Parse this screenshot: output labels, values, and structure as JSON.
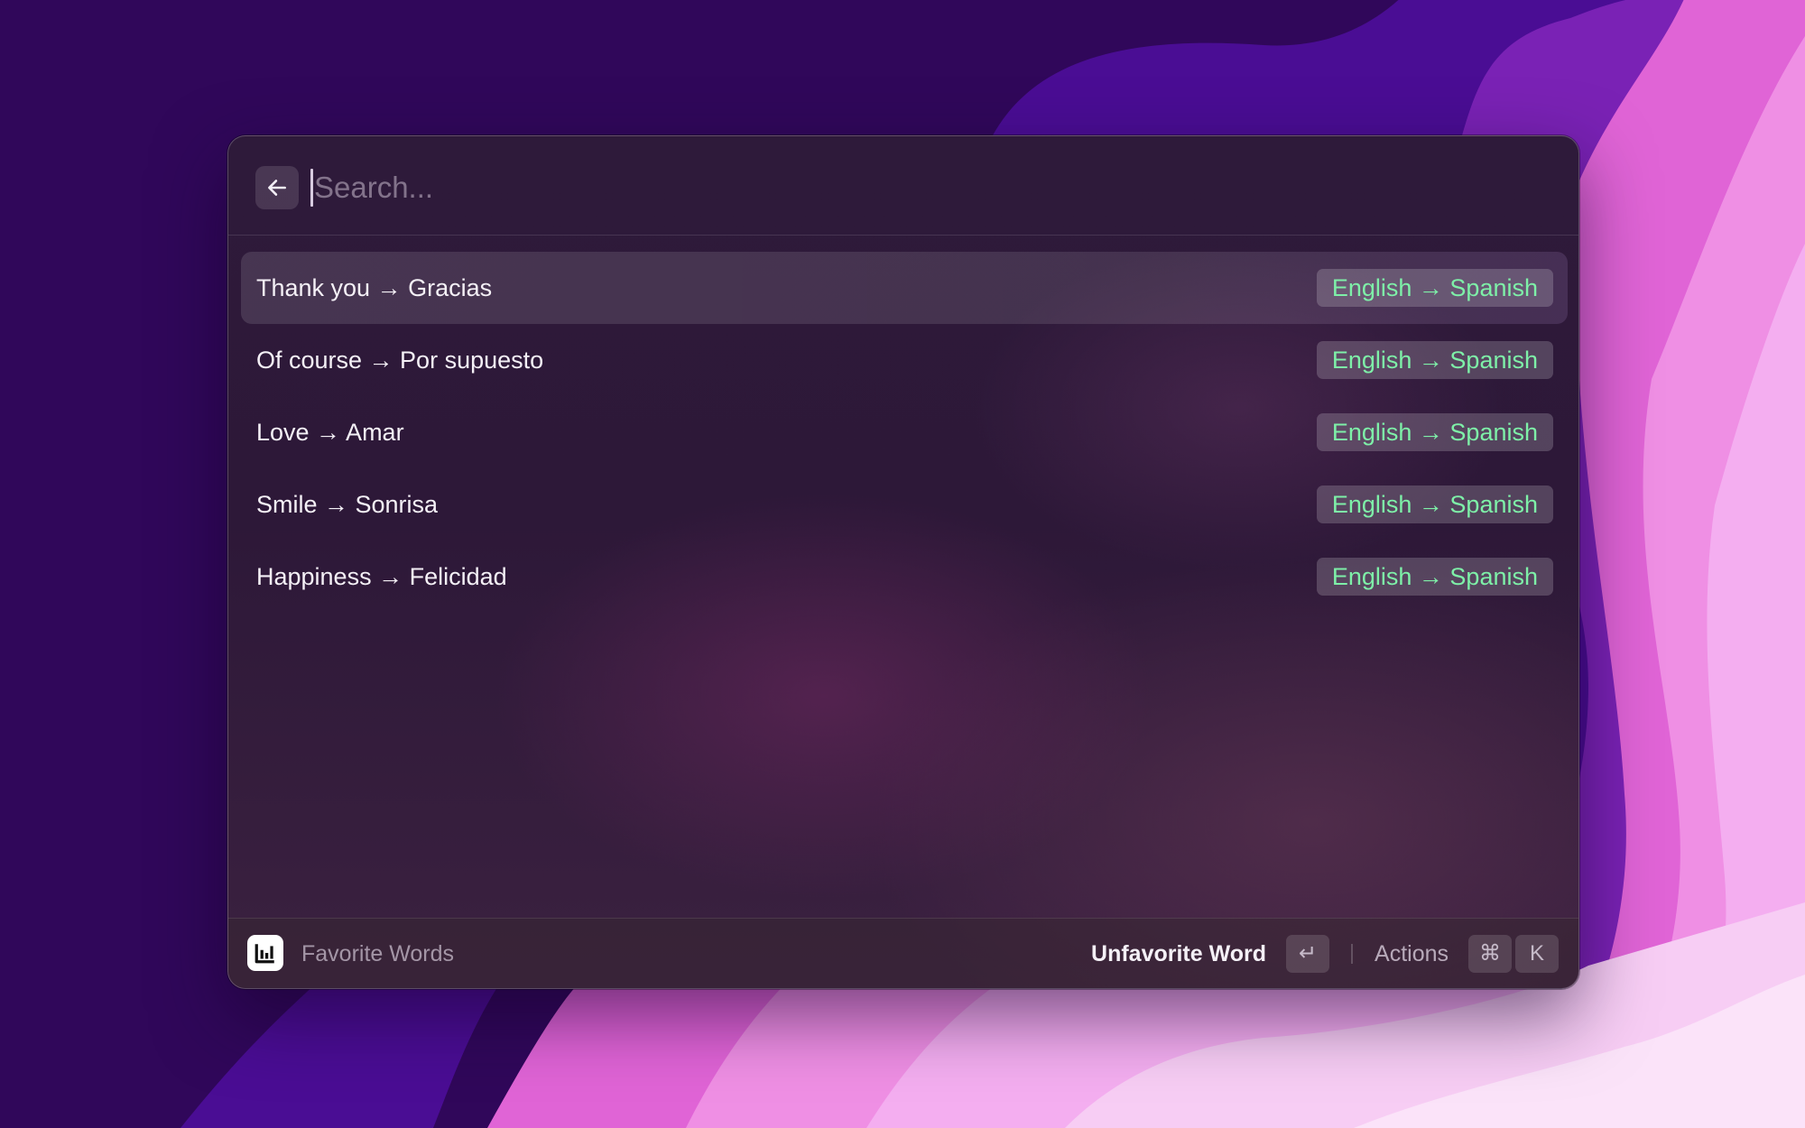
{
  "search": {
    "placeholder": "Search..."
  },
  "results": [
    {
      "title": "Thank you → Gracias",
      "tag": "English → Spanish",
      "selected": true
    },
    {
      "title": "Of course → Por supuesto",
      "tag": "English → Spanish",
      "selected": false
    },
    {
      "title": "Love → Amar",
      "tag": "English → Spanish",
      "selected": false
    },
    {
      "title": "Smile → Sonrisa",
      "tag": "English → Spanish",
      "selected": false
    },
    {
      "title": "Happiness → Felicidad",
      "tag": "English → Spanish",
      "selected": false
    }
  ],
  "footer": {
    "command_title": "Favorite Words",
    "primary_action": "Unfavorite Word",
    "primary_key": "↵",
    "actions_label": "Actions",
    "actions_keys": [
      "⌘",
      "K"
    ]
  },
  "icons": {
    "back": "arrow-left-icon",
    "app": "extension-app-icon"
  },
  "colors": {
    "tag_text": "#7ef0a8",
    "wallpaper_primary": "#30075a",
    "wallpaper_accent": "#e86fdc"
  }
}
